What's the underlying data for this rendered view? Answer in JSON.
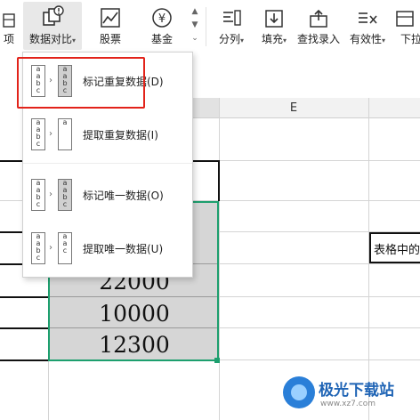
{
  "ribbon": {
    "cut_left_label": "项",
    "compare": {
      "label": "数据对比",
      "caret": "▾"
    },
    "stock": {
      "label": "股票"
    },
    "fund": {
      "label": "基金"
    },
    "split": {
      "label": "分列",
      "caret": "▾"
    },
    "fill": {
      "label": "填充",
      "caret": "▾"
    },
    "lookup": {
      "label": "查找录入"
    },
    "validity": {
      "label": "有效性",
      "caret": "▾"
    },
    "dropdown_list": {
      "label": "下拉"
    },
    "scroll_up": "▲",
    "scroll_down": "▼",
    "expand": "⌄"
  },
  "sheet": {
    "column_e": "E",
    "cells": [
      "22000",
      "10000",
      "12300"
    ],
    "right_cell_text": "表格中的"
  },
  "menu": {
    "items": [
      {
        "label": "标记重复数据(D)"
      },
      {
        "label": "提取重复数据(I)"
      },
      {
        "label": "标记唯一数据(O)"
      },
      {
        "label": "提取唯一数据(U)"
      }
    ],
    "icon_letters": [
      "a",
      "a",
      "b",
      "c"
    ],
    "arrow": "›"
  },
  "watermark": {
    "name": "极光下载站",
    "url": "www.xz7.com"
  },
  "colors": {
    "selection_green": "#1d9f6e",
    "highlight_red": "#e2231a",
    "cell_fill_gray": "#d6d6d6"
  }
}
